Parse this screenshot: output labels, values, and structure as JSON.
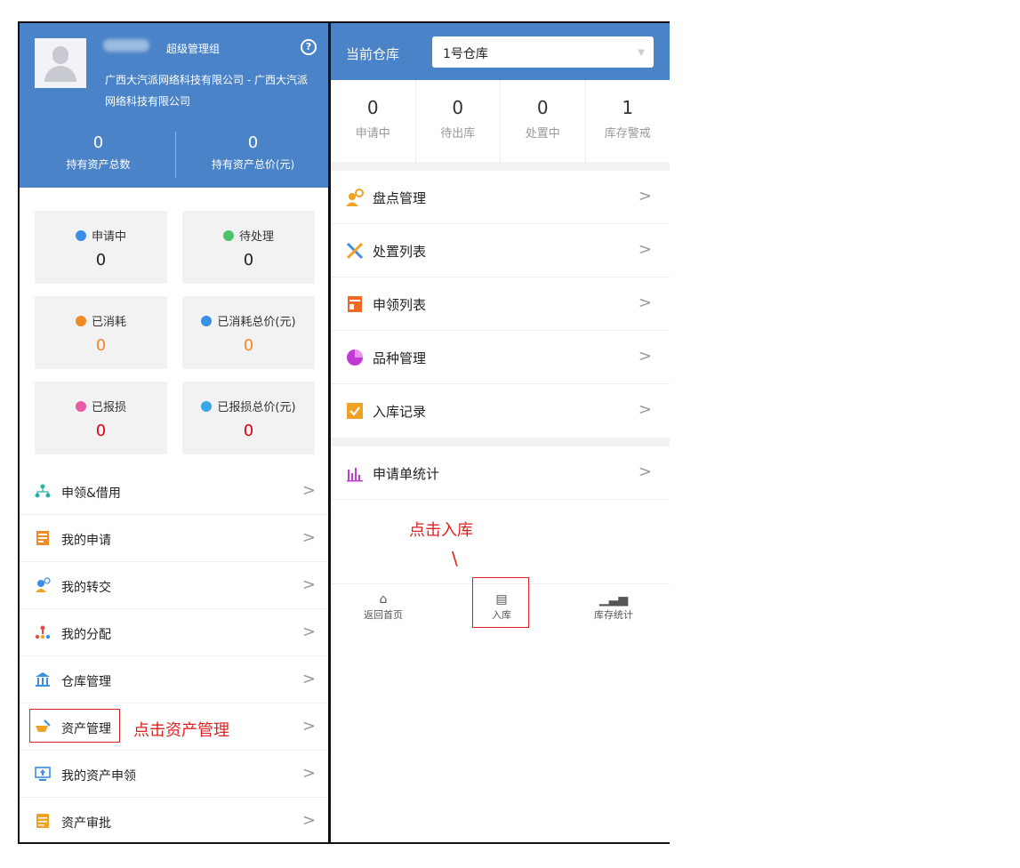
{
  "left": {
    "profile": {
      "role": "超级管理组",
      "company": "广西大汽派网络科技有限公司 - 广西大汽派网络科技有限公司",
      "help_symbol": "?",
      "stats": [
        {
          "value": "0",
          "label": "持有资产总数"
        },
        {
          "value": "0",
          "label": "持有资产总价(元)"
        }
      ]
    },
    "cards": [
      {
        "label": "申请中",
        "value": "0",
        "color": "#222222",
        "icon": "application-icon",
        "icon_color": "#3a8ee6"
      },
      {
        "label": "待处理",
        "value": "0",
        "color": "#222222",
        "icon": "pending-icon",
        "icon_color": "#4cc36b"
      },
      {
        "label": "已消耗",
        "value": "0",
        "color": "#f08a24",
        "icon": "consumed-icon",
        "icon_color": "#f08a24"
      },
      {
        "label": "已消耗总价(元)",
        "value": "0",
        "color": "#f08a24",
        "icon": "consumed-total-icon",
        "icon_color": "#3a8ee6"
      },
      {
        "label": "已报损",
        "value": "0",
        "color": "#d9001b",
        "icon": "damaged-icon",
        "icon_color": "#e85aa8"
      },
      {
        "label": "已报损总价(元)",
        "value": "0",
        "color": "#d9001b",
        "icon": "damaged-total-icon",
        "icon_color": "#3aa8e6"
      }
    ],
    "menu": [
      {
        "label": "申领&借用",
        "icon": "network-icon",
        "icon_color": "#26b3a6"
      },
      {
        "label": "我的申请",
        "icon": "form-icon",
        "icon_color": "#f08a24"
      },
      {
        "label": "我的转交",
        "icon": "user-transfer-icon",
        "icon_color": "#3a8ee6"
      },
      {
        "label": "我的分配",
        "icon": "hierarchy-icon",
        "icon_color": "#e84a4a"
      },
      {
        "label": "仓库管理",
        "icon": "warehouse-icon",
        "icon_color": "#3a8ee6"
      },
      {
        "label": "资产管理",
        "icon": "asset-icon",
        "icon_color": "#f0a224"
      },
      {
        "label": "我的资产申领",
        "icon": "monitor-icon",
        "icon_color": "#3a8ee6"
      },
      {
        "label": "资产审批",
        "icon": "document-icon",
        "icon_color": "#f0a224"
      }
    ],
    "chevron": ">",
    "annotation": "点击资产管理"
  },
  "right": {
    "warehouse_label": "当前仓库",
    "warehouse_value": "1号仓库",
    "counts": [
      {
        "value": "0",
        "label": "申请中"
      },
      {
        "value": "0",
        "label": "待出库"
      },
      {
        "value": "0",
        "label": "处置中"
      },
      {
        "value": "1",
        "label": "库存警戒"
      }
    ],
    "menu": [
      {
        "label": "盘点管理",
        "icon": "inventory-check-icon",
        "icon_color": "#f0a224"
      },
      {
        "label": "处置列表",
        "icon": "tools-icon",
        "icon_color": "#3a8ee6"
      },
      {
        "label": "申领列表",
        "icon": "form-icon",
        "icon_color": "#f06a24"
      },
      {
        "label": "品种管理",
        "icon": "pie-icon",
        "icon_color": "#c23ad6"
      },
      {
        "label": "入库记录",
        "icon": "checkbox-icon",
        "icon_color": "#f0a224"
      }
    ],
    "stats_item": {
      "label": "申请单统计",
      "icon": "bar-chart-icon",
      "icon_color": "#c23ad6"
    },
    "chevron": ">",
    "annotation": "点击入库",
    "annotation_pointer": "\\",
    "tabs": [
      {
        "label": "返回首页",
        "icon": "home-icon"
      },
      {
        "label": "入库",
        "icon": "stock-in-icon"
      },
      {
        "label": "库存统计",
        "icon": "stats-icon"
      }
    ]
  }
}
